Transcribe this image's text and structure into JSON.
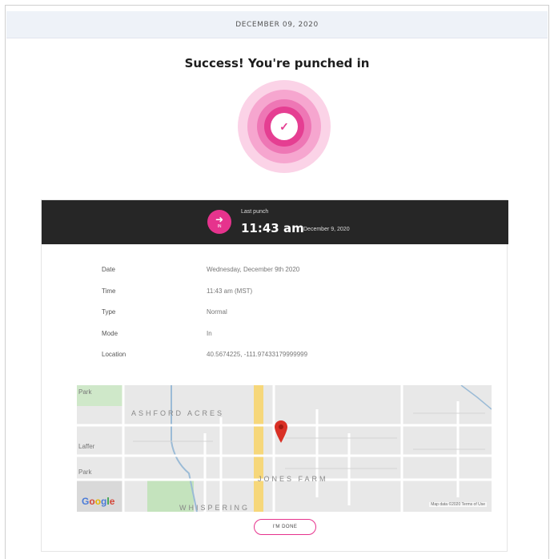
{
  "header": {
    "date": "DECEMBER 09, 2020"
  },
  "title": "Success! You're punched in",
  "last_punch": {
    "label": "Last punch",
    "time": "11:43 am",
    "date": "December 9, 2020",
    "mode_badge": "IN",
    "icon": "sign-in-icon"
  },
  "details": [
    {
      "key": "Date",
      "value": "Wednesday, December 9th 2020"
    },
    {
      "key": "Time",
      "value": "11:43 am (MST)"
    },
    {
      "key": "Type",
      "value": "Normal"
    },
    {
      "key": "Mode",
      "value": "In"
    },
    {
      "key": "Location",
      "value": "40.5674225, -111.97433179999999"
    }
  ],
  "map": {
    "area_labels": [
      "ASHFORD ACRES",
      "JONES FARM",
      "WHISPERING"
    ],
    "edge_labels": [
      "Park",
      "Laffer",
      "Park"
    ],
    "logo": "Google",
    "attribution": "Map data ©2020   Terms of Use"
  },
  "done_button": "I'M DONE",
  "colors": {
    "accent": "#e53e92",
    "dark_bar": "#262626",
    "date_bar": "#eef2f8"
  }
}
